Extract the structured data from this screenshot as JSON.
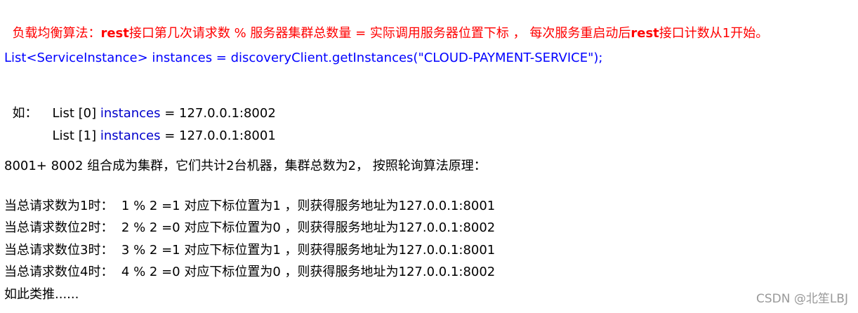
{
  "intro": {
    "part1": "负载均衡算法：",
    "part2": "rest",
    "part3": "接口第几次请求数 % 服务器集群总数量 = 实际调用服务器位置下标 ， 每次服务重启动后",
    "part4": "rest",
    "part5": "接口计数从1开始。"
  },
  "code_line": "List<ServiceInstance> instances = discoveryClient.getInstances(\"CLOUD-PAYMENT-SERVICE\");",
  "example": {
    "prefix": "如：",
    "items": [
      {
        "list": "List [0] ",
        "var": "instances",
        "value": " = 127.0.0.1:8002"
      },
      {
        "list": "List [1] ",
        "var": "instances",
        "value": " = 127.0.0.1:8001"
      }
    ]
  },
  "cluster_line": "8001+ 8002 组合成为集群，它们共计2台机器，集群总数为2， 按照轮询算法原理：",
  "rules": [
    "当总请求数为1时：  1 % 2 =1 对应下标位置为1 ，则获得服务地址为127.0.0.1:8001",
    "当总请求数位2时：  2 % 2 =0 对应下标位置为0 ，则获得服务地址为127.0.0.1:8002",
    "当总请求数位3时：  3 % 2 =1 对应下标位置为1 ，则获得服务地址为127.0.0.1:8001",
    "当总请求数位4时：  4 % 2 =0 对应下标位置为0 ，则获得服务地址为127.0.0.1:8002"
  ],
  "ellipsis_line": "如此类推......",
  "watermark": "CSDN @北笙LBJ",
  "colors": {
    "intro": "#ff0000",
    "code": "#0000ff",
    "variable": "#0000cc",
    "watermark": "#999999"
  }
}
